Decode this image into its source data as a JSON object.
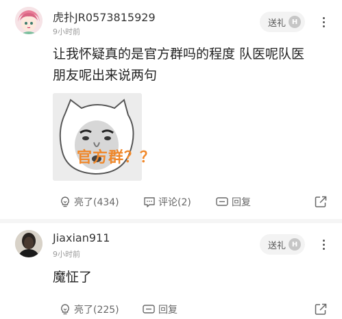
{
  "comments": [
    {
      "username": "虎扑JR0573815929",
      "time": "9小时前",
      "gift_label": "送礼",
      "gift_badge": "H",
      "text_line1": "让我怀疑真的是官方群吗的程度 队医呢队医",
      "text_line2": "朋友呢出来说两句",
      "meme_caption": "官方群？？",
      "likes_label": "亮了(434)",
      "comments_label": "评论(2)",
      "reply_label": "回复"
    },
    {
      "username": "Jiaxian911",
      "time": "9小时前",
      "gift_label": "送礼",
      "gift_badge": "H",
      "text": "魔怔了",
      "likes_label": "亮了(225)",
      "reply_label": "回复"
    }
  ],
  "colors": {
    "meme_caption": "#f0882a",
    "badge": "#c6c6c6",
    "gift_bg": "#f3f3f3"
  }
}
